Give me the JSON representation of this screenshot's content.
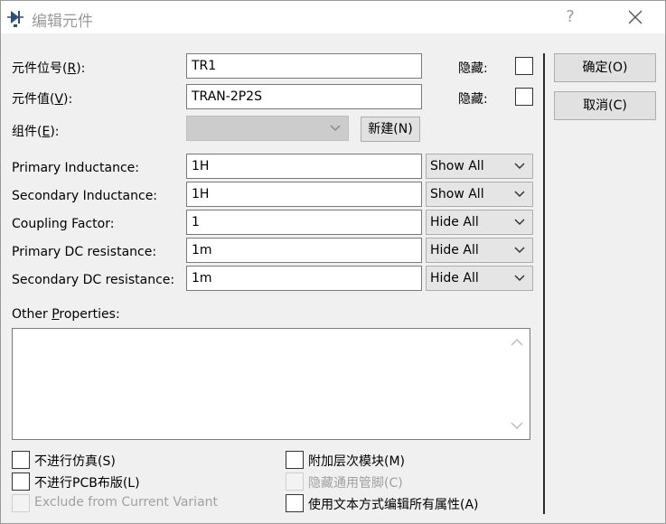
{
  "window": {
    "title": "编辑元件",
    "help_label": "?"
  },
  "fields": {
    "ref_label": "元件位号(R):",
    "ref_value": "TR1",
    "value_label": "元件值(V):",
    "value_value": "TRAN-2P2S",
    "group_label": "组件(E):",
    "group_value": "",
    "hide_label": "隐藏:",
    "new_button": "新建(N)"
  },
  "properties": [
    {
      "label": "Primary Inductance:",
      "value": "1H",
      "visibility": "Show All"
    },
    {
      "label": "Secondary Inductance:",
      "value": "1H",
      "visibility": "Show All"
    },
    {
      "label": "Coupling Factor:",
      "value": "1",
      "visibility": "Hide All"
    },
    {
      "label": "Primary DC resistance:",
      "value": "1m",
      "visibility": "Hide All"
    },
    {
      "label": "Secondary DC resistance:",
      "value": "1m",
      "visibility": "Hide All"
    }
  ],
  "other_properties": {
    "label_pre": "Other ",
    "label_u": "P",
    "label_post": "roperties:",
    "text": ""
  },
  "options": {
    "no_sim": "不进行仿真(S)",
    "no_pcb": "不进行PCB布版(L)",
    "exclude_variant": "Exclude from Current Variant",
    "attach_hier": "附加层次模块(M)",
    "hide_common_pins": "隐藏通用管脚(C)",
    "edit_as_text": "使用文本方式编辑所有属性(A)"
  },
  "buttons": {
    "ok": "确定(O)",
    "cancel": "取消(C)"
  }
}
